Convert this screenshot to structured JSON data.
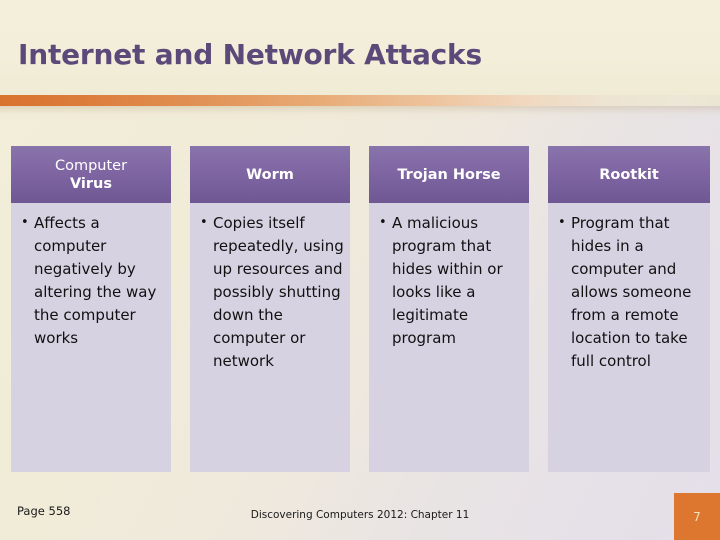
{
  "slide": {
    "title": "Internet and Network Attacks",
    "title_color": "#5b4a79",
    "accent_color": "#dd7730",
    "header_fill": "#7b63a0",
    "body_fill": "#d7d2e2"
  },
  "table": {
    "columns": [
      {
        "header_line1": "Computer",
        "header_line2": "Virus",
        "bullets": [
          "Affects a computer negatively by altering the way the computer works"
        ]
      },
      {
        "header_line1": "Worm",
        "header_line2": "",
        "bullets": [
          "Copies itself repeatedly, using up resources and possibly shutting down the computer or network"
        ]
      },
      {
        "header_line1": "Trojan Horse",
        "header_line2": "",
        "bullets": [
          "A malicious program that hides within or looks like a legitimate program"
        ]
      },
      {
        "header_line1": "Rootkit",
        "header_line2": "",
        "bullets": [
          "Program that hides in a computer and allows someone from a remote location to take full control"
        ]
      }
    ]
  },
  "footer": {
    "page_reference": "Page 558",
    "source": "Discovering Computers 2012: Chapter 11",
    "slide_number": "7"
  }
}
